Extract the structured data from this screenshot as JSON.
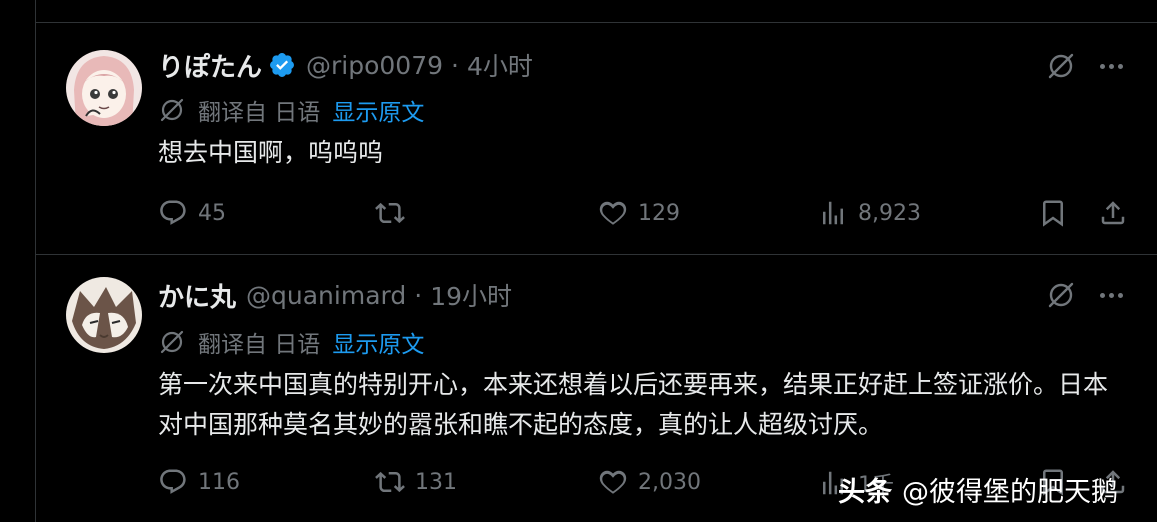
{
  "tweets": [
    {
      "name": "りぽたん",
      "verified": true,
      "handle": "@ripo0079",
      "separator": "·",
      "time": "4小时",
      "translated_from": "翻译自 日语",
      "show_original": "显示原文",
      "text": "想去中国啊，呜呜呜",
      "replies": "45",
      "reposts": "",
      "likes": "129",
      "views": "8,923"
    },
    {
      "name": "かに丸",
      "verified": false,
      "handle": "@quanimard",
      "separator": "·",
      "time": "19小时",
      "translated_from": "翻译自 日语",
      "show_original": "显示原文",
      "text": "第一次来中国真的特别开心，本来还想着以后还要再来，结果正好赶上签证涨价。日本对中国那种莫名其妙的嚣张和瞧不起的态度，真的让人超级讨厌。",
      "replies": "116",
      "reposts": "131",
      "likes": "2,030",
      "views": "1千"
    }
  ],
  "watermark": {
    "logo": "头条",
    "text": "@彼得堡的肥天鹅"
  },
  "colors": {
    "background": "#000000",
    "text": "#e7e9ea",
    "muted": "#71767b",
    "accent": "#1d9bf0",
    "divider": "#2f3336"
  },
  "icons": [
    "verified-badge-icon",
    "grok-icon",
    "more-icon",
    "translate-icon",
    "reply-icon",
    "repost-icon",
    "like-icon",
    "views-icon",
    "bookmark-icon",
    "share-icon"
  ]
}
